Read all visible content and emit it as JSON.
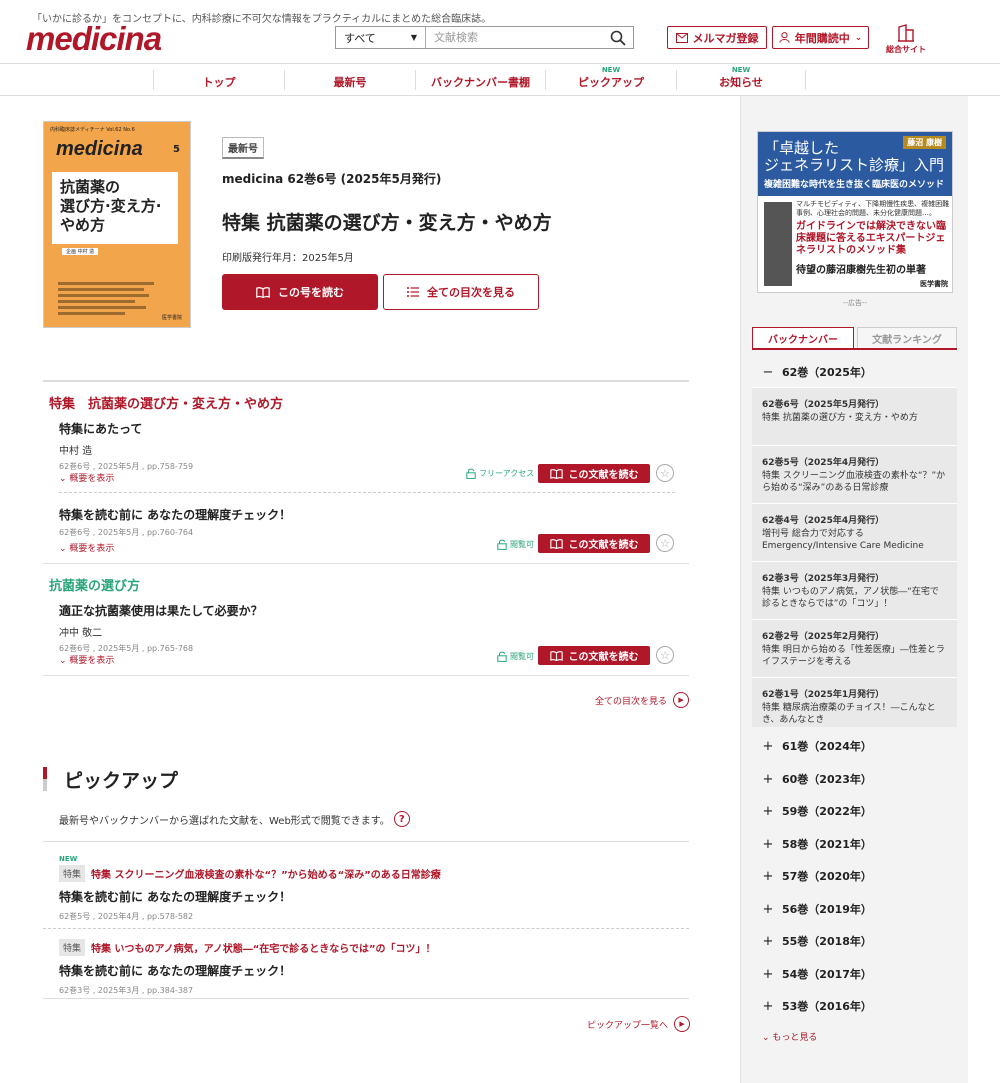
{
  "header": {
    "tagline": "「いかに診るか」をコンセプトに、内科診療に不可欠な情報をプラクティカルにまとめた総合臨床誌。",
    "logo": "medicina",
    "search_select": "すべて",
    "search_placeholder": "文献検索",
    "mail_label": "メルマガ登録",
    "subscribe_label": "年間購読中",
    "site_label": "総合サイト"
  },
  "nav": {
    "items": [
      {
        "label": "トップ",
        "new": ""
      },
      {
        "label": "最新号",
        "new": ""
      },
      {
        "label": "バックナンバー書棚",
        "new": ""
      },
      {
        "label": "ピックアップ",
        "new": "NEW"
      },
      {
        "label": "お知らせ",
        "new": "NEW"
      }
    ]
  },
  "cover": {
    "top": "内科臨床誌メディチーナ Vol.62 No.6",
    "logo": "medicina",
    "num": "5",
    "title": "抗菌薬の\n選び方·変え方·\nやめ方",
    "author": "企画 中村 造",
    "publisher": "医学書院"
  },
  "issue": {
    "tag": "最新号",
    "name": "medicina 62巻6号 (2025年5月発行)",
    "title": "特集 抗菌薬の選び方・変え方・やめ方",
    "print_date": "印刷版発行年月：2025年5月",
    "read_label": "この号を読む",
    "toc_label": "全ての目次を見る"
  },
  "toc": {
    "section1": "特集　抗菌薬の選び方・変え方・やめ方",
    "section2": "抗菌薬の選び方",
    "abstract_label": "概要を表示",
    "read_article_label": "この文献を読む",
    "articles": [
      {
        "title": "特集にあたって",
        "author": "中村 造",
        "meta": "62巻6号 , 2025年5月 , pp.758-759",
        "access": "フリーアクセス"
      },
      {
        "title": "特集を読む前に あなたの理解度チェック！",
        "author": "",
        "meta": "62巻6号 , 2025年5月 , pp.760-764",
        "access": "閲覧可"
      },
      {
        "title": "適正な抗菌薬使用は果たして必要か？",
        "author": "冲中 敬二",
        "meta": "62巻6号 , 2025年5月 , pp.765-768",
        "access": "閲覧可"
      }
    ],
    "all_toc_link": "全ての目次を見る"
  },
  "pickup": {
    "title": "ピックアップ",
    "desc": "最新号やバックナンバーから選ばれた文献を、Web形式で閲覧できます。",
    "help": "?",
    "items": [
      {
        "new": "NEW",
        "tag": "特集",
        "special": "特集 スクリーニング血液検査の素朴な“？”から始める“深み”のある日常診療",
        "title": "特集を読む前に あなたの理解度チェック！",
        "meta": "62巻5号 , 2025年4月 , pp.578-582"
      },
      {
        "new": "",
        "tag": "特集",
        "special": "特集 いつものアノ病気，アノ状態―“在宅で診るときならでは”の「コツ」！",
        "title": "特集を読む前に あなたの理解度チェック！",
        "meta": "62巻3号 , 2025年3月 , pp.384-387"
      }
    ],
    "more": "ピックアップ一覧へ"
  },
  "ad": {
    "author": "藤沼 康樹",
    "h1": "「卓越した\nジェネラリスト診療」入門",
    "h2": "複雑困難な時代を生き抜く臨床医のメソッド",
    "t1": "マルチモビディティ、下降期慢性疾患、複雑困難事例、心理社会的問題、未分化健康問題…。",
    "t2": "ガイドラインでは解決できない臨床課題に答えるエキスパートジェネラリストのメソッド集",
    "t3": "待望の藤沼康樹先生初の単著",
    "pub": "医学書院",
    "note": "--広告--"
  },
  "sidebar": {
    "tab_backnumber": "バックナンバー",
    "tab_ranking": "文献ランキング",
    "current_volume": "62巻（2025年）",
    "issues": [
      {
        "no": "62巻6号（2025年5月発行）",
        "sp": "特集 抗菌薬の選び方・変え方・やめ方"
      },
      {
        "no": "62巻5号（2025年4月発行）",
        "sp": "特集 スクリーニング血液検査の素朴な“？”から始める“深み”のある日常診療"
      },
      {
        "no": "62巻4号（2025年4月発行）",
        "sp": "増刊号 総合力で対応するEmergency/Intensive Care Medicine"
      },
      {
        "no": "62巻3号（2025年3月発行）",
        "sp": "特集 いつものアノ病気，アノ状態―“在宅で診るときならでは”の「コツ」！"
      },
      {
        "no": "62巻2号（2025年2月発行）",
        "sp": "特集 明日から始める「性差医療」―性差とライフステージを考える"
      },
      {
        "no": "62巻1号（2025年1月発行）",
        "sp": "特集 糖尿病治療薬のチョイス！―こんなとき、あんなとき"
      }
    ],
    "volumes": [
      "61巻（2024年）",
      "60巻（2023年）",
      "59巻（2022年）",
      "58巻（2021年）",
      "57巻（2020年）",
      "56巻（2019年）",
      "55巻（2018年）",
      "54巻（2017年）",
      "53巻（2016年）"
    ],
    "more": "もっと見る"
  }
}
